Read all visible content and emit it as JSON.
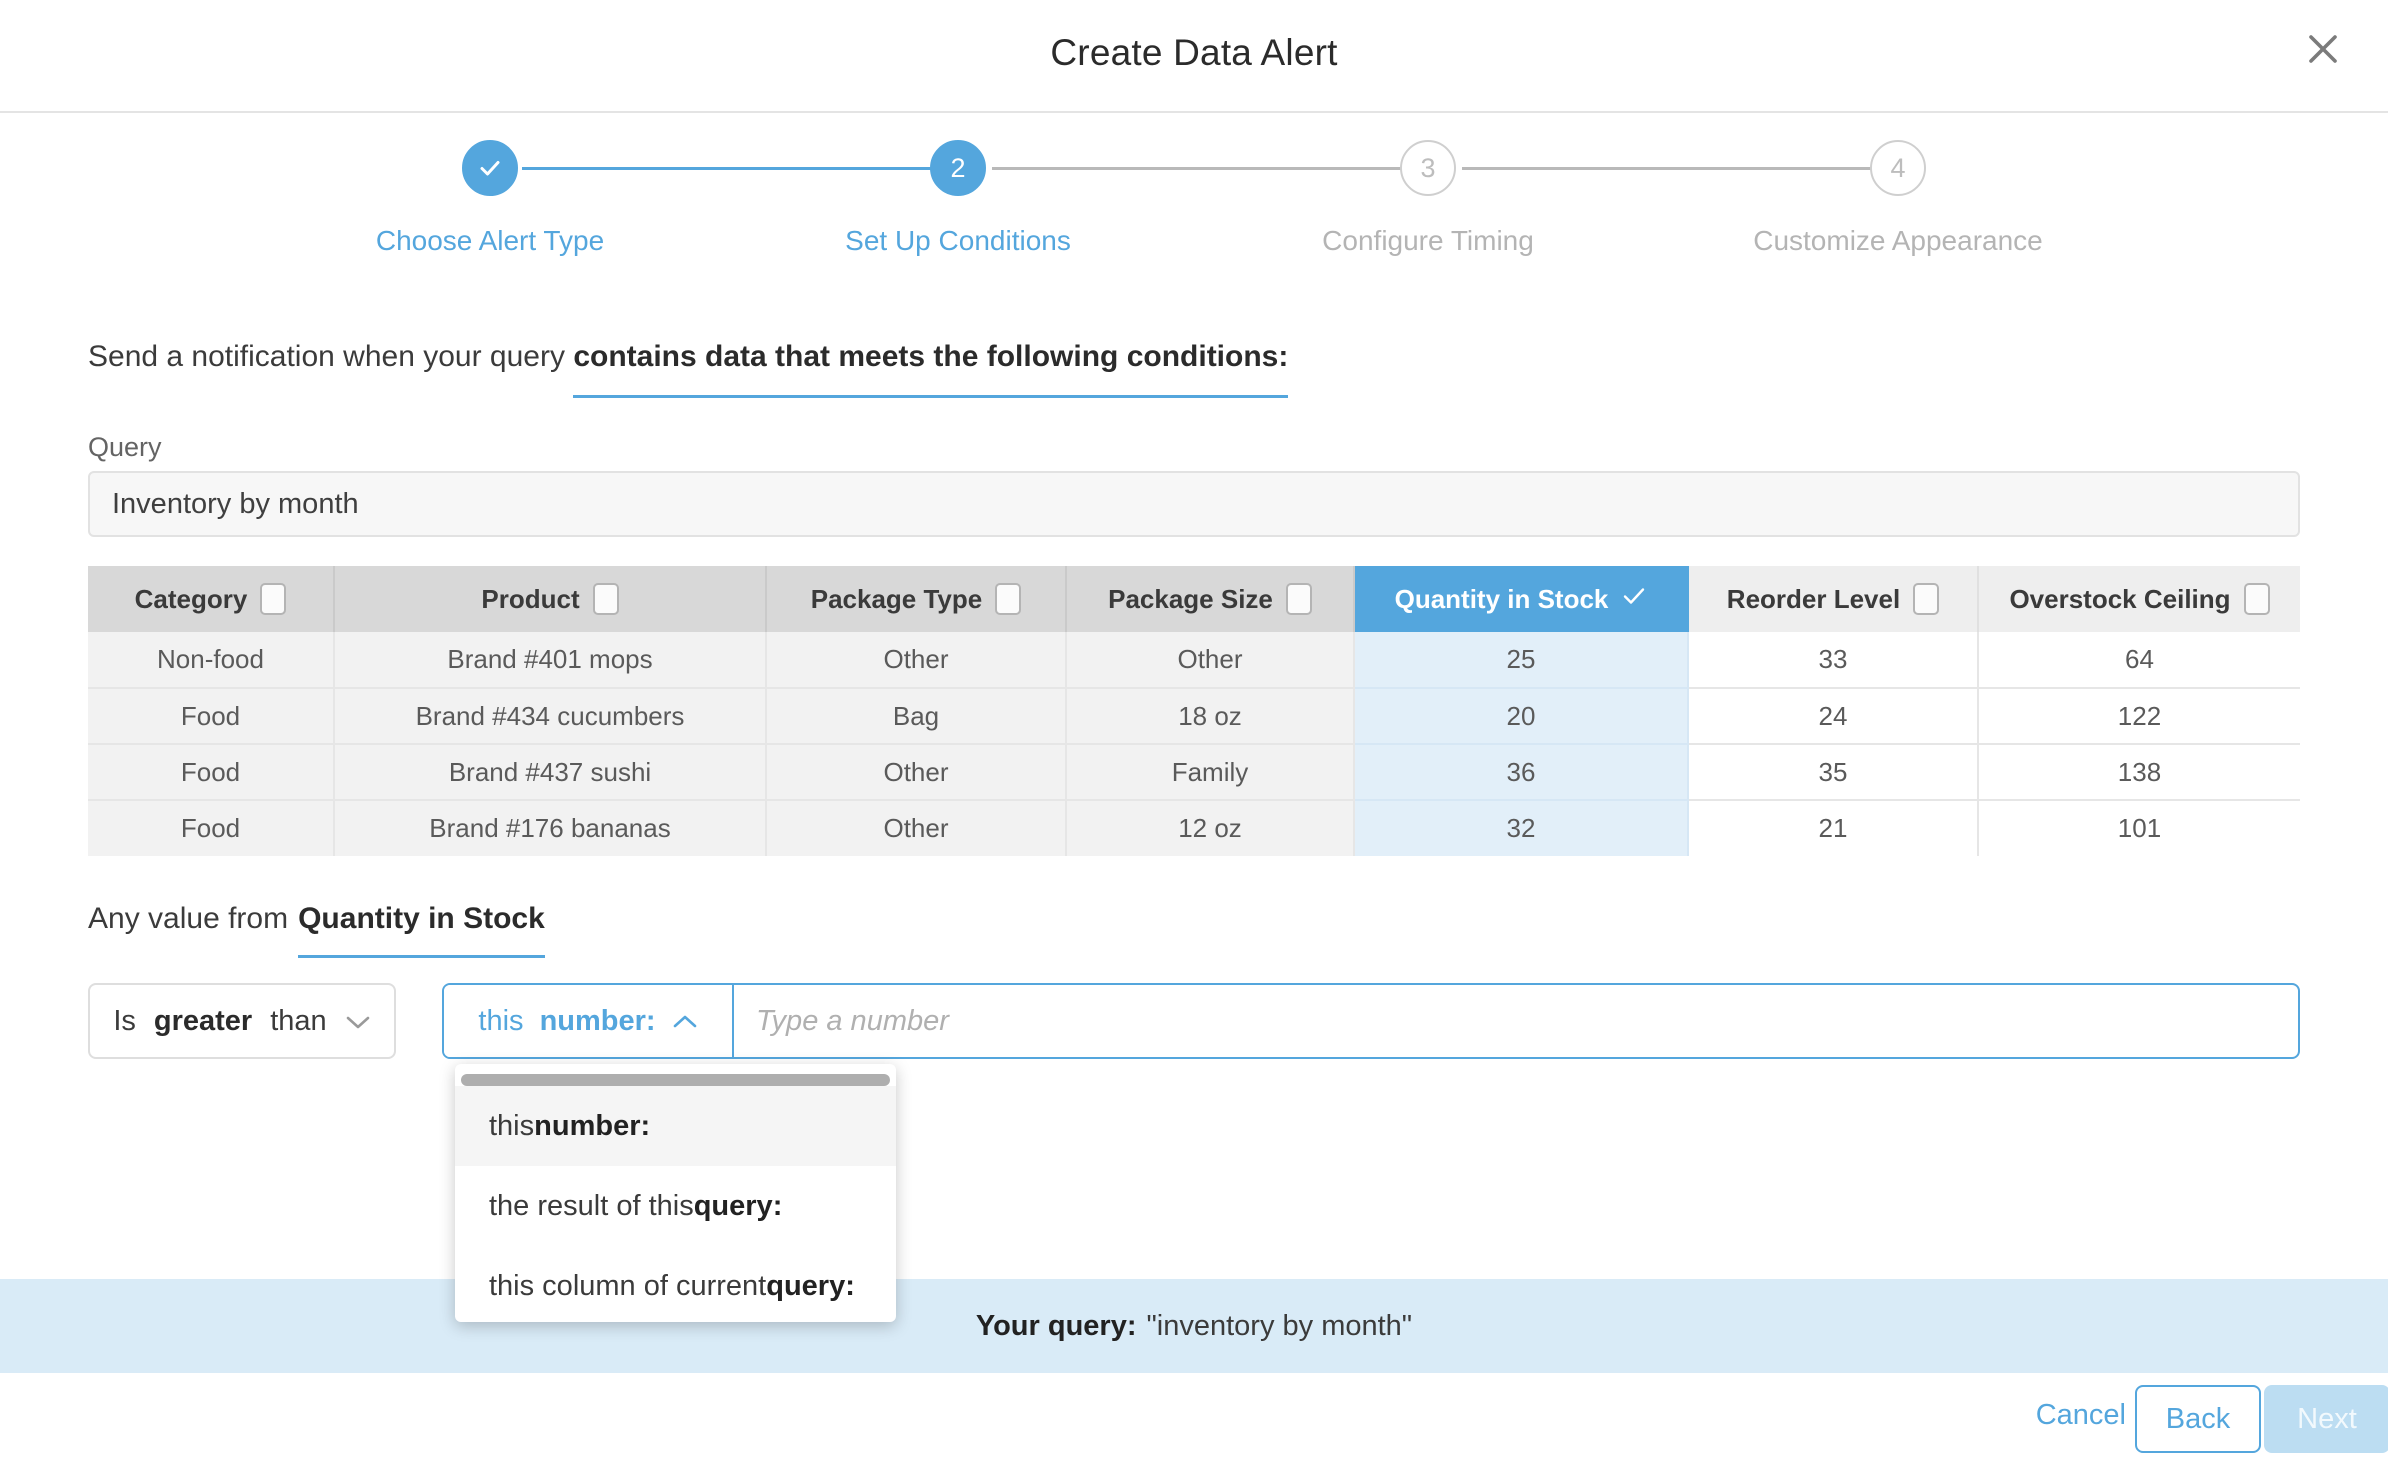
{
  "dialog": {
    "title": "Create Data Alert",
    "close_icon": "close-icon"
  },
  "stepper": {
    "steps": [
      {
        "number": "✓",
        "label": "Choose Alert Type",
        "state": "done"
      },
      {
        "number": "2",
        "label": "Set Up Conditions",
        "state": "active"
      },
      {
        "number": "3",
        "label": "Configure Timing",
        "state": "todo"
      },
      {
        "number": "4",
        "label": "Customize Appearance",
        "state": "todo"
      }
    ]
  },
  "condition_sentence": {
    "prefix": "Send a notification when your query ",
    "highlight": "contains data that meets the following conditions:"
  },
  "query": {
    "label": "Query",
    "value": "Inventory by month"
  },
  "table": {
    "columns": [
      {
        "label": "Category",
        "selected": false,
        "tone": "dark"
      },
      {
        "label": "Product",
        "selected": false,
        "tone": "dark"
      },
      {
        "label": "Package Type",
        "selected": false,
        "tone": "dark"
      },
      {
        "label": "Package Size",
        "selected": false,
        "tone": "dark"
      },
      {
        "label": "Quantity in Stock",
        "selected": true,
        "tone": "blue"
      },
      {
        "label": "Reorder Level",
        "selected": false,
        "tone": "light"
      },
      {
        "label": "Overstock Ceiling",
        "selected": false,
        "tone": "light"
      }
    ],
    "rows": [
      [
        "Non-food",
        "Brand #401 mops",
        "Other",
        "Other",
        "25",
        "33",
        "64"
      ],
      [
        "Food",
        "Brand #434 cucumbers",
        "Bag",
        "18 oz",
        "20",
        "24",
        "122"
      ],
      [
        "Food",
        "Brand #437 sushi",
        "Other",
        "Family",
        "36",
        "35",
        "138"
      ],
      [
        "Food",
        "Brand #176 bananas",
        "Other",
        "12 oz",
        "32",
        "21",
        "101"
      ]
    ]
  },
  "any_value": {
    "prefix": "Any value from",
    "column": "Quantity in Stock"
  },
  "operator": {
    "prefix": "Is",
    "strong": "greater",
    "suffix": "than",
    "chevron": "chevron-down-icon"
  },
  "value_control": {
    "type_prefix": "this ",
    "type_strong": "number:",
    "chevron": "chevron-up-icon",
    "input_value": "",
    "input_placeholder": "Type a number"
  },
  "dropdown": {
    "items": [
      {
        "prefix": "this ",
        "strong": "number:"
      },
      {
        "prefix": "the result of this ",
        "strong": "query:"
      },
      {
        "prefix": "this column of current ",
        "strong": "query:"
      }
    ]
  },
  "banner": {
    "label": "Your query:",
    "value": "\"inventory by month\""
  },
  "footer": {
    "cancel": "Cancel",
    "back": "Back",
    "next": "Next"
  },
  "colors": {
    "accent": "#54a6dd",
    "selected_cell": "#e2eff9",
    "banner_bg": "#d9ebf7",
    "next_disabled": "#bcddf2"
  }
}
